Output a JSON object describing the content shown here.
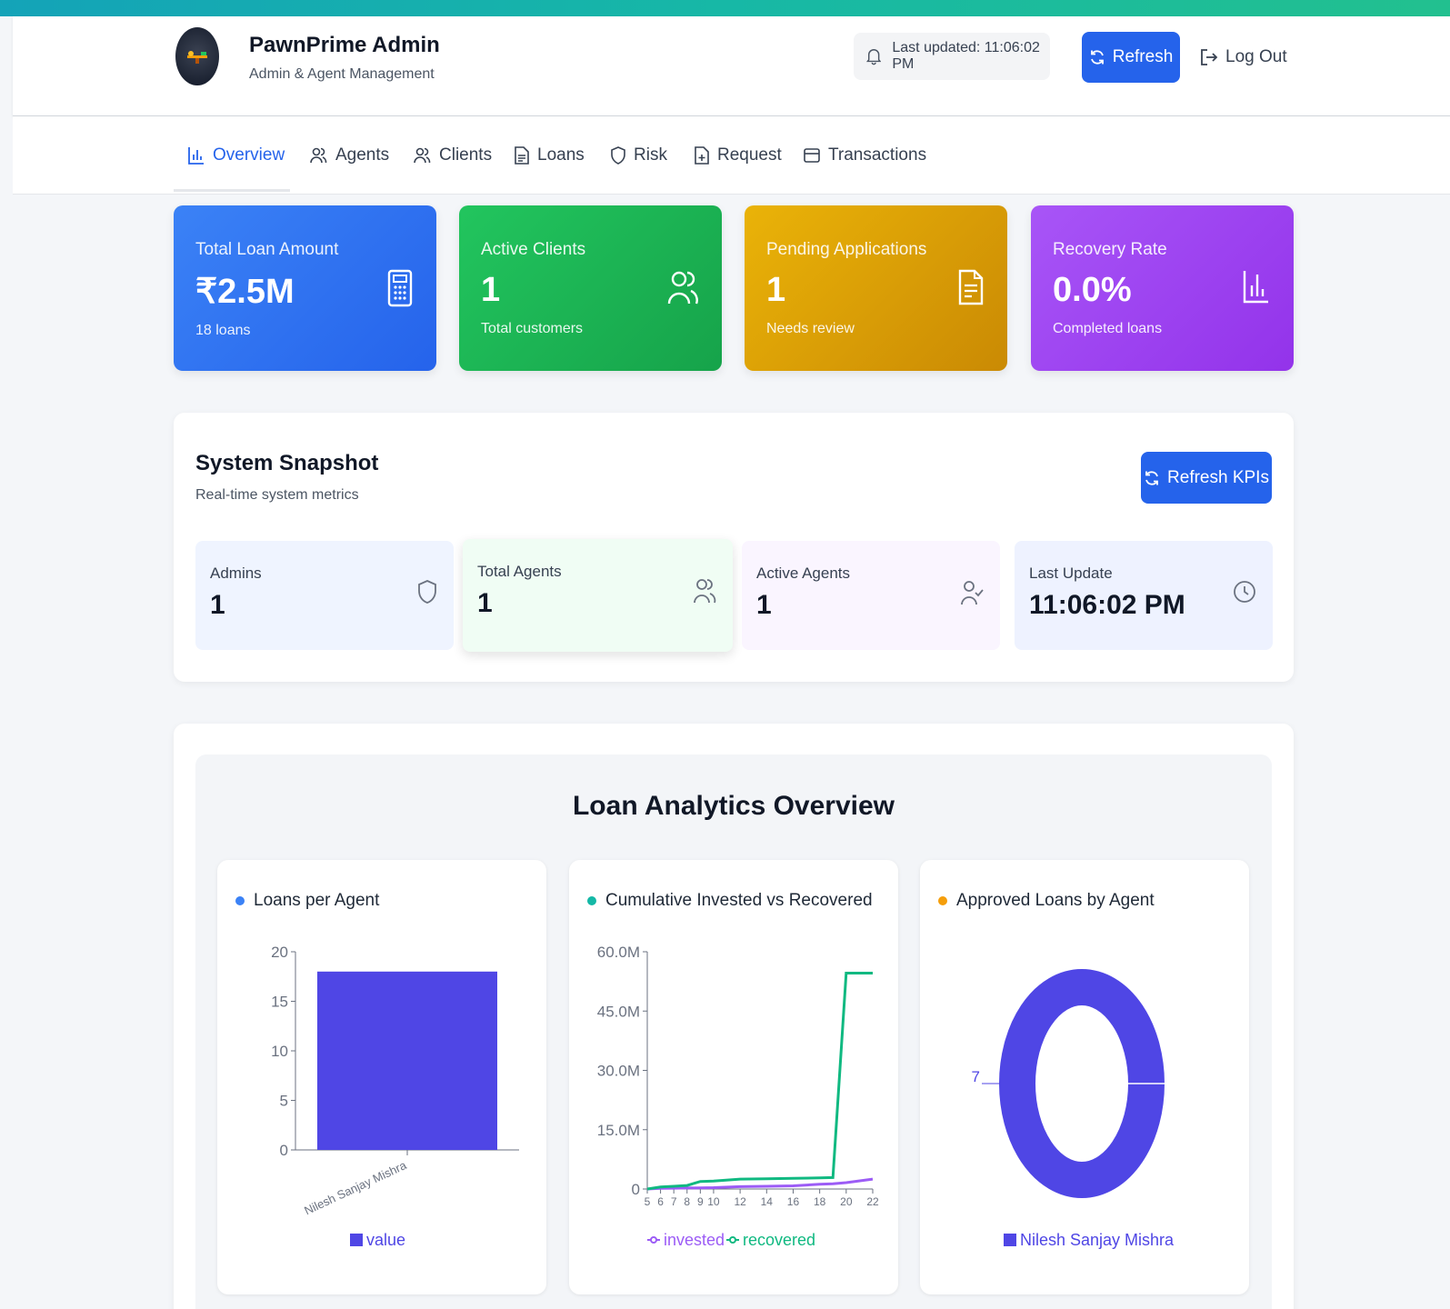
{
  "header": {
    "title": "PawnPrime Admin",
    "subtitle": "Admin & Agent Management",
    "last_updated": "Last updated: 11:06:02 PM",
    "refresh_label": "Refresh",
    "logout_label": "Log Out"
  },
  "tabs": [
    {
      "label": "Overview",
      "icon": "bar-chart-icon",
      "active": true
    },
    {
      "label": "Agents",
      "icon": "users-icon"
    },
    {
      "label": "Clients",
      "icon": "users-icon"
    },
    {
      "label": "Loans",
      "icon": "file-text-icon"
    },
    {
      "label": "Risk",
      "icon": "shield-icon"
    },
    {
      "label": "Request",
      "icon": "file-plus-icon"
    },
    {
      "label": "Transactions",
      "icon": "credit-card-icon"
    }
  ],
  "kpis": [
    {
      "label": "Total Loan Amount",
      "value": "₹2.5M",
      "sub": "18 loans",
      "icon": "calculator-icon",
      "color": "#2563eb"
    },
    {
      "label": "Active Clients",
      "value": "1",
      "sub": "Total customers",
      "icon": "users-icon",
      "color": "#16a34a"
    },
    {
      "label": "Pending Applications",
      "value": "1",
      "sub": "Needs review",
      "icon": "file-text-icon",
      "color": "#ca8a04"
    },
    {
      "label": "Recovery Rate",
      "value": "0.0%",
      "sub": "Completed loans",
      "icon": "bar-chart-icon",
      "color": "#9333ea"
    }
  ],
  "snapshot": {
    "title": "System Snapshot",
    "subtitle": "Real-time system metrics",
    "refresh_label": "Refresh KPIs",
    "items": [
      {
        "label": "Admins",
        "value": "1",
        "icon": "shield-icon"
      },
      {
        "label": "Total Agents",
        "value": "1",
        "icon": "users-icon"
      },
      {
        "label": "Active Agents",
        "value": "1",
        "icon": "user-check-icon"
      },
      {
        "label": "Last Update",
        "value": "11:06:02 PM",
        "icon": "clock-icon"
      }
    ]
  },
  "analytics": {
    "title": "Loan Analytics Overview",
    "charts": [
      {
        "title": "Loans per Agent",
        "dot_color": "#3b82f6"
      },
      {
        "title": "Cumulative Invested vs Recovered",
        "dot_color": "#14b8a6"
      },
      {
        "title": "Approved Loans by Agent",
        "dot_color": "#f59e0b"
      }
    ]
  },
  "chart_data": [
    {
      "type": "bar",
      "categories": [
        "Nilesh Sanjay Mishra"
      ],
      "series": [
        {
          "name": "value",
          "values": [
            18
          ],
          "color": "#4f46e5"
        }
      ],
      "yticks": [
        "0",
        "5",
        "10",
        "15",
        "20"
      ],
      "ylim": [
        0,
        20
      ],
      "legend": "bottom"
    },
    {
      "type": "line",
      "x": [
        5,
        6,
        7,
        8,
        9,
        10,
        12,
        14,
        16,
        18,
        19,
        20,
        22
      ],
      "xticks": [
        "5",
        "6",
        "7",
        "8",
        "9",
        "10",
        "12",
        "14",
        "16",
        "18",
        "20",
        "22"
      ],
      "yticks": [
        "0",
        "15.0M",
        "30.0M",
        "45.0M",
        "60.0M"
      ],
      "ylim": [
        0,
        60000000
      ],
      "series": [
        {
          "name": "invested",
          "color": "#9c5cf6",
          "values": [
            0,
            150000,
            200000,
            250000,
            300000,
            350000,
            600000,
            700000,
            800000,
            1200000,
            1300000,
            1600000,
            2500000
          ]
        },
        {
          "name": "recovered",
          "color": "#10b981",
          "values": [
            0,
            500000,
            700000,
            900000,
            1900000,
            2000000,
            2500000,
            2600000,
            2700000,
            2800000,
            2900000,
            54600000,
            54600000
          ]
        }
      ],
      "legend": "bottom"
    },
    {
      "type": "pie",
      "labels": [
        "Nilesh Sanjay Mishra"
      ],
      "values": [
        7
      ],
      "data_labels": [
        "7"
      ],
      "color": "#4f46e5",
      "legend": "bottom"
    }
  ]
}
